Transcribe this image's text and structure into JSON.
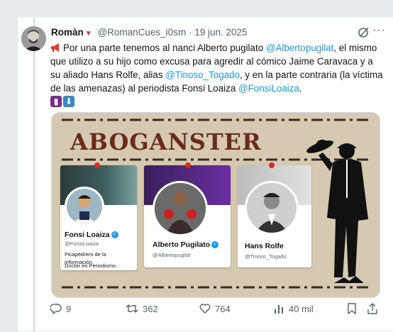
{
  "author": {
    "name": "Romàn",
    "handle": "@RomanCues_i0sm",
    "separator": "·",
    "date": "19 jun. 2025"
  },
  "tweet": {
    "segments": [
      {
        "t": "Por una parte tenemos al nanci Alberto pugilato ",
        "link": false
      },
      {
        "t": "@Albertopugilat",
        "link": true
      },
      {
        "t": ", el mismo que utilizo a su hijo como excusa para agredir al cómico Jaime Caravaca y a su aliado Hans Rolfe, alias ",
        "link": false
      },
      {
        "t": "@Tinoso_Togado",
        "link": true
      },
      {
        "t": ", y en la parte contraria (la víctima de las amenazas) al periodista Fonsi Loaiza ",
        "link": false
      },
      {
        "t": "@FonsiLoaiza",
        "link": true
      },
      {
        "t": ".",
        "link": false
      }
    ]
  },
  "media": {
    "title": "ABOGANSTER",
    "cards": [
      {
        "name": "Fonsi Loaiza",
        "handle": "@FonsiLoaiza",
        "bio1": "Picapedrero de la información.",
        "bio2": "Doctor en Periodismo."
      },
      {
        "name": "Alberto Pugilato",
        "handle": "@Albertopugilat"
      },
      {
        "name": "Hans Rolfe",
        "handle": "@Tinoso_Togado"
      }
    ]
  },
  "actions": {
    "replies": "9",
    "retweets": "362",
    "likes": "764",
    "views": "40 mil"
  },
  "colors": {
    "link": "#1d9bf0",
    "muted": "#536471",
    "title_red": "#6b2a20",
    "background": "#d6c9b1"
  },
  "icons": [
    "megaphone-emoji",
    "thread-spool-emoji",
    "down-arrow-emoji",
    "grok-icon",
    "more-icon",
    "reply-icon",
    "retweet-icon",
    "like-icon",
    "views-icon",
    "bookmark-icon",
    "share-icon"
  ]
}
